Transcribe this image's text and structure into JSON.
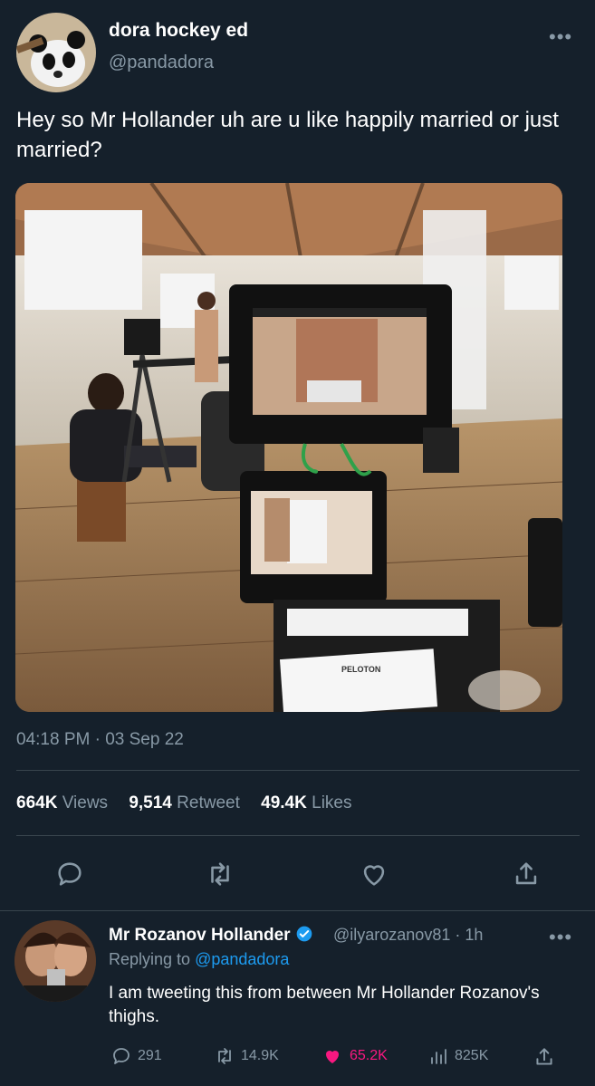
{
  "tweet": {
    "author_name": "dora hockey ed",
    "author_handle": "@pandadora",
    "more_label": "•••",
    "text": "Hey so Mr Hollander uh are u like happily married or just married?",
    "timestamp": "04:18 PM · 03 Sep 22",
    "media": {
      "monitor_label": "PELOTON"
    },
    "stats": {
      "views_count": "664K",
      "views_label": "Views",
      "retweets_count": "9,514",
      "retweets_label": "Retweet",
      "likes_count": "49.4K",
      "likes_label": "Likes"
    },
    "actions": [
      "reply-icon",
      "retweet-icon",
      "like-icon",
      "share-icon"
    ]
  },
  "reply": {
    "author_name": "Mr Rozanov Hollander",
    "author_handle": "@ilyarozanov81 · 1h",
    "more_label": "•••",
    "replying_prefix": "Replying to",
    "replying_handle": "@pandadora",
    "text": "I am tweeting this from between Mr Hollander Rozanov's thighs.",
    "actions": {
      "reply_count": "291",
      "retweet_count": "14.9K",
      "like_count": "65.2K",
      "views_count": "825K"
    }
  },
  "colors": {
    "background": "#15202b",
    "secondary_text": "#8899a6",
    "link": "#1d9bf0",
    "verified": "#1d9bf0",
    "like": "#f91880",
    "divider": "#38444d"
  }
}
